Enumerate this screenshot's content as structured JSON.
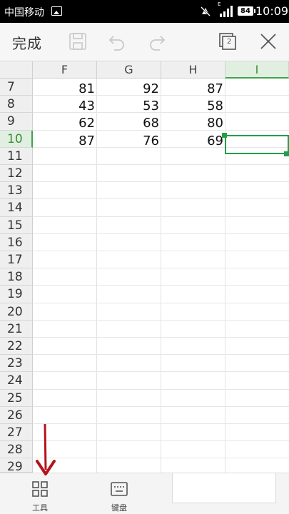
{
  "status_bar": {
    "carrier": "中国移动",
    "network_type": "E",
    "battery": "84",
    "time": "10:09"
  },
  "toolbar": {
    "done_label": "完成",
    "sheet_count": "2",
    "icons": [
      "save-icon",
      "undo-icon",
      "redo-icon",
      "sheets-icon",
      "close-icon"
    ]
  },
  "grid": {
    "columns": [
      "F",
      "G",
      "H",
      "I"
    ],
    "rows": [
      "7",
      "8",
      "9",
      "10",
      "11",
      "12",
      "13",
      "14",
      "15",
      "16",
      "17",
      "18",
      "19",
      "20",
      "21",
      "22",
      "23",
      "24",
      "25",
      "26",
      "27",
      "28",
      "29"
    ],
    "active_column": "I",
    "active_row": "10",
    "cells": [
      [
        "81",
        "92",
        "87",
        ""
      ],
      [
        "43",
        "53",
        "58",
        ""
      ],
      [
        "62",
        "68",
        "80",
        ""
      ],
      [
        "87",
        "76",
        "69",
        ""
      ]
    ]
  },
  "bottom_bar": {
    "tools_label": "工具",
    "keyboard_label": "键盘"
  },
  "colors": {
    "accent": "#21a049",
    "arrow": "#b3141c"
  }
}
